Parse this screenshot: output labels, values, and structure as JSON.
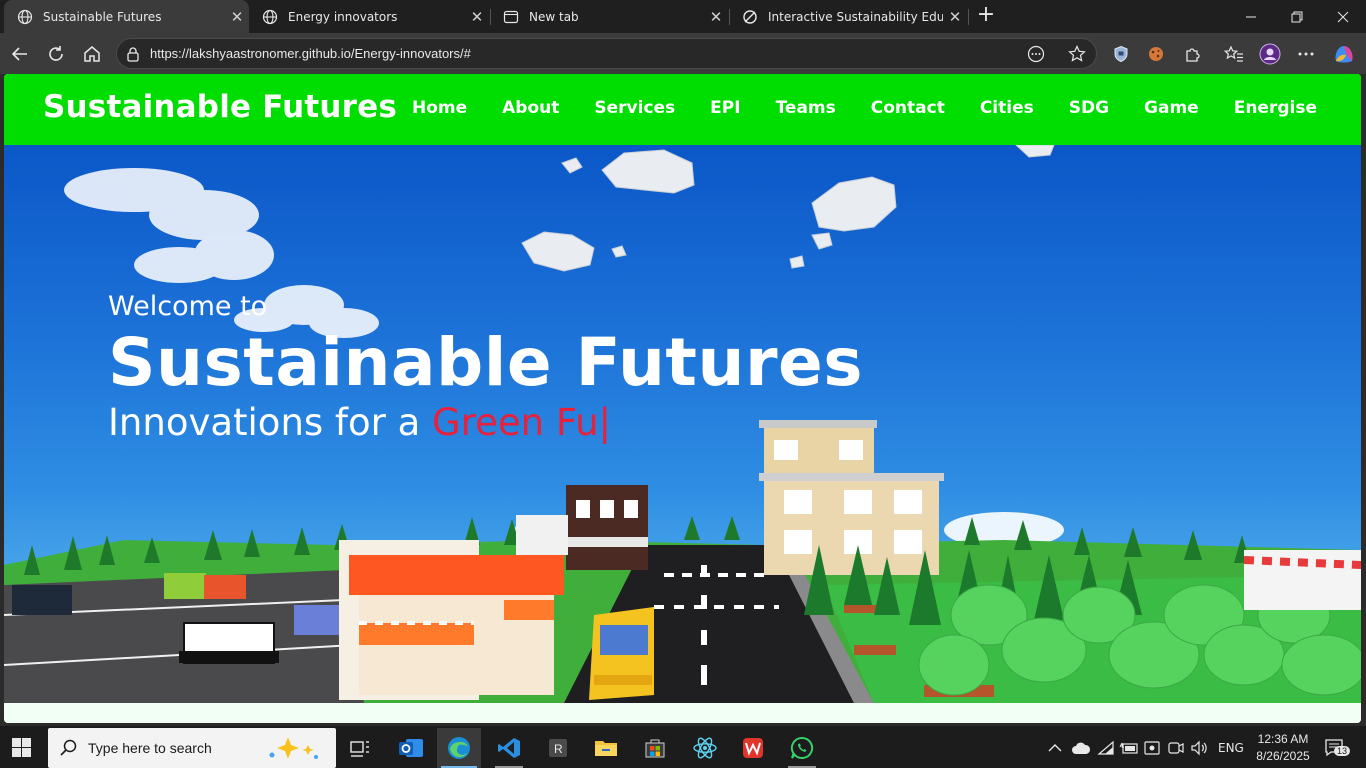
{
  "browser": {
    "tabs": [
      {
        "title": "Sustainable Futures",
        "active": true
      },
      {
        "title": "Energy innovators",
        "active": false
      },
      {
        "title": "New tab",
        "active": false
      },
      {
        "title": "Interactive Sustainability Educatio",
        "active": false
      }
    ],
    "url": "https://lakshyaastronomer.github.io/Energy-innovators/#"
  },
  "site": {
    "brand": "Sustainable Futures",
    "nav": [
      "Home",
      "About",
      "Services",
      "EPI",
      "Teams",
      "Contact",
      "Cities",
      "SDG",
      "Game",
      "Energise"
    ],
    "hero": {
      "welcome": "Welcome to",
      "headline": "Sustainable Futures",
      "tagline_prefix": "Innovations for a ",
      "tagline_typed": "Green Fu",
      "caret": "|"
    },
    "colors": {
      "nav_bg": "#00dd00",
      "typed_text": "#e8203a"
    }
  },
  "taskbar": {
    "search_placeholder": "Type here to search",
    "language": "ENG",
    "time": "12:36 AM",
    "date": "8/26/2025",
    "notification_count": "13",
    "apps": [
      "task-view",
      "outlook",
      "edge",
      "vscode",
      "r-studio",
      "file-explorer",
      "microsoft-store",
      "react-devtools",
      "wps-office",
      "whatsapp"
    ]
  }
}
